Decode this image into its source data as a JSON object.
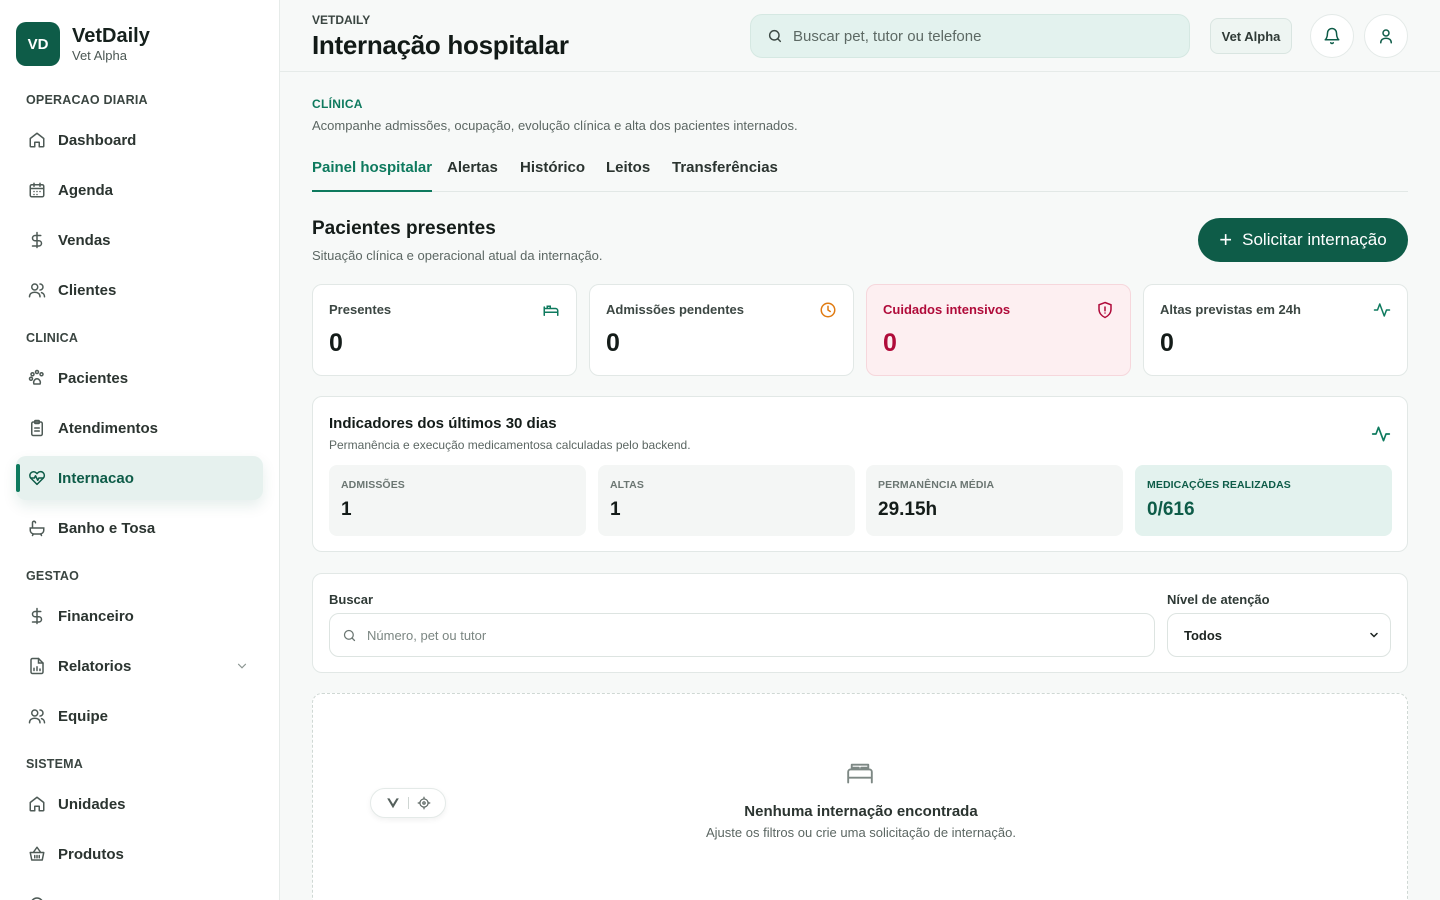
{
  "colors": {
    "brand": "#0e5c48",
    "accent": "#0e7a5e",
    "alert": "#b00b3a",
    "warning": "#e07b12",
    "surface_tint": "#e3f2ee"
  },
  "brand": {
    "logo_initials": "VD",
    "name": "VetDaily",
    "unit": "Vet Alpha"
  },
  "sidebar": {
    "sections": [
      {
        "title": "OPERACAO DIARIA",
        "items": [
          {
            "label": "Dashboard",
            "icon": "home-icon"
          },
          {
            "label": "Agenda",
            "icon": "calendar-icon"
          },
          {
            "label": "Vendas",
            "icon": "dollar-icon"
          },
          {
            "label": "Clientes",
            "icon": "users-icon"
          }
        ]
      },
      {
        "title": "CLINICA",
        "items": [
          {
            "label": "Pacientes",
            "icon": "paw-icon"
          },
          {
            "label": "Atendimentos",
            "icon": "clipboard-icon"
          },
          {
            "label": "Internacao",
            "icon": "heart-pulse-icon",
            "active": true
          },
          {
            "label": "Banho e Tosa",
            "icon": "bath-icon"
          }
        ]
      },
      {
        "title": "GESTAO",
        "items": [
          {
            "label": "Financeiro",
            "icon": "dollar-icon"
          },
          {
            "label": "Relatorios",
            "icon": "report-icon",
            "expandable": true
          },
          {
            "label": "Equipe",
            "icon": "users-icon"
          }
        ]
      },
      {
        "title": "SISTEMA",
        "items": [
          {
            "label": "Unidades",
            "icon": "home-icon"
          },
          {
            "label": "Produtos",
            "icon": "basket-icon"
          }
        ]
      }
    ]
  },
  "header": {
    "kicker": "VETDAILY",
    "title": "Internação hospitalar",
    "search_placeholder": "Buscar pet, tutor ou telefone",
    "unit_badge": "Vet Alpha"
  },
  "section": {
    "kicker": "CLÍNICA",
    "description": "Acompanhe admissões, ocupação, evolução clínica e alta dos pacientes internados."
  },
  "tabs": [
    {
      "label": "Painel hospitalar",
      "active": true
    },
    {
      "label": "Alertas"
    },
    {
      "label": "Histórico"
    },
    {
      "label": "Leitos"
    },
    {
      "label": "Transferências"
    }
  ],
  "patients": {
    "title": "Pacientes presentes",
    "subtitle": "Situação clínica e operacional atual da internação.",
    "cta": "Solicitar internação"
  },
  "stats": [
    {
      "label": "Presentes",
      "value": "0",
      "icon": "bed-icon"
    },
    {
      "label": "Admissões pendentes",
      "value": "0",
      "icon": "clock-icon"
    },
    {
      "label": "Cuidados intensivos",
      "value": "0",
      "icon": "shield-alert-icon"
    },
    {
      "label": "Altas previstas em 24h",
      "value": "0",
      "icon": "activity-icon"
    }
  ],
  "indicators": {
    "title": "Indicadores dos últimos 30 dias",
    "subtitle": "Permanência e execução medicamentosa calculadas pelo backend.",
    "items": [
      {
        "label": "ADMISSÕES",
        "value": "1"
      },
      {
        "label": "ALTAS",
        "value": "1"
      },
      {
        "label": "PERMANÊNCIA MÉDIA",
        "value": "29.15h"
      },
      {
        "label": "MEDICAÇÕES REALIZADAS",
        "value": "0/616"
      }
    ]
  },
  "filters": {
    "search_label": "Buscar",
    "search_placeholder": "Número, pet ou tutor",
    "attention_label": "Nível de atenção",
    "attention_value": "Todos"
  },
  "empty": {
    "title": "Nenhuma internação encontrada",
    "subtitle": "Ajuste os filtros ou crie uma solicitação de internação."
  }
}
